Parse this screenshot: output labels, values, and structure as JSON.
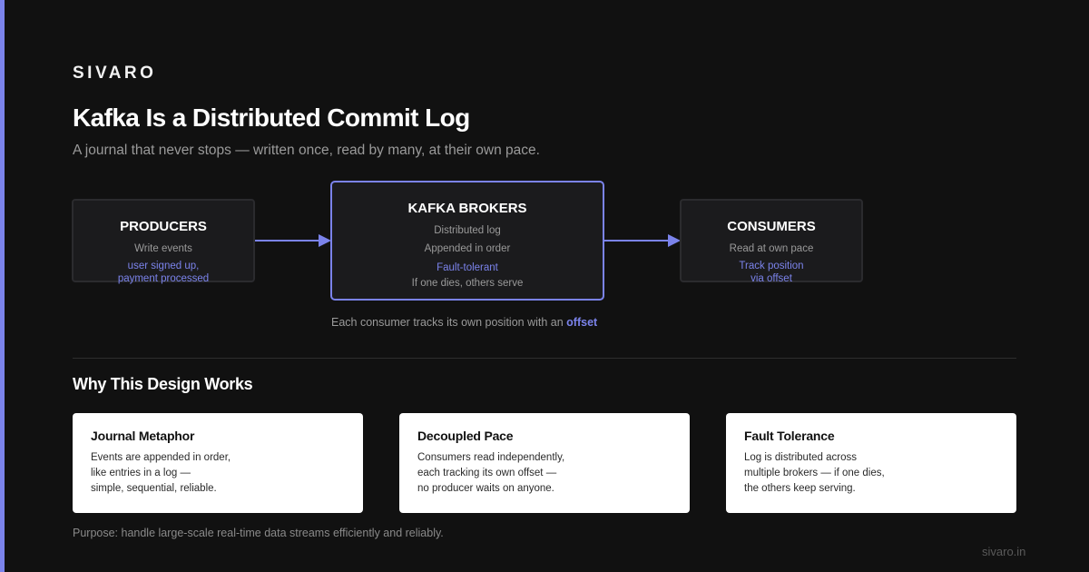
{
  "brand": "SIVARO",
  "title": "Kafka Is a Distributed Commit Log",
  "subtitle": "A journal that never stops — written once, read by many, at their own pace.",
  "accent_color": "#7b83eb",
  "diagram": {
    "producers": {
      "title": "PRODUCERS",
      "line": "Write events",
      "accent_lines": [
        "user signed up,",
        "payment processed"
      ]
    },
    "kafka": {
      "title": "KAFKA BROKERS",
      "lines": [
        "Distributed log",
        "Appended in order"
      ],
      "accent": "Fault-tolerant",
      "footer_line": "If one dies, others serve"
    },
    "consumers": {
      "title": "CONSUMERS",
      "line": "Read at own pace",
      "accent_lines": [
        "Track position",
        "via offset"
      ]
    },
    "offset_note": {
      "text": "Each consumer tracks its own position with an ",
      "highlight": "offset"
    }
  },
  "section_title": "Why This Design Works",
  "cards": [
    {
      "title": "Journal Metaphor",
      "lines": [
        "Events are appended in order,",
        "like entries in a log —",
        "simple, sequential, reliable."
      ]
    },
    {
      "title": "Decoupled Pace",
      "lines": [
        "Consumers read independently,",
        "each tracking its own offset —",
        "no producer waits on anyone."
      ]
    },
    {
      "title": "Fault Tolerance",
      "lines": [
        "Log is distributed across",
        "multiple brokers — if one dies,",
        "the others keep serving."
      ]
    }
  ],
  "purpose": "Purpose: handle large-scale real-time data streams efficiently and reliably.",
  "footer": "sivaro.in"
}
